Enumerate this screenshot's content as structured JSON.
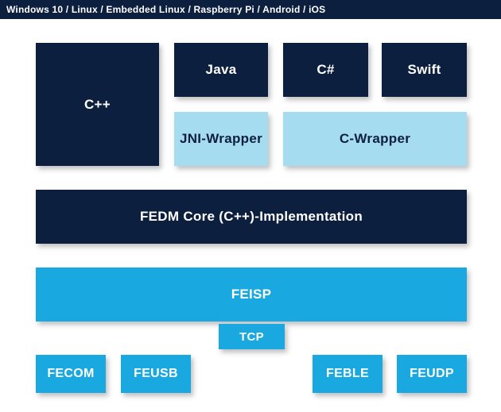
{
  "header": {
    "title": "Windows 10 / Linux / Embedded Linux / Raspberry Pi / Android / iOS"
  },
  "blocks": {
    "cpp": "C++",
    "java": "Java",
    "csharp": "C#",
    "swift": "Swift",
    "jni_wrapper": "JNI-Wrapper",
    "c_wrapper": "C-Wrapper",
    "fedm_core": "FEDM Core (C++)-Implementation",
    "feisp": "FEISP",
    "tcp": "TCP",
    "fecom": "FECOM",
    "feusb": "FEUSB",
    "feble": "FEBLE",
    "feudp": "FEUDP"
  }
}
